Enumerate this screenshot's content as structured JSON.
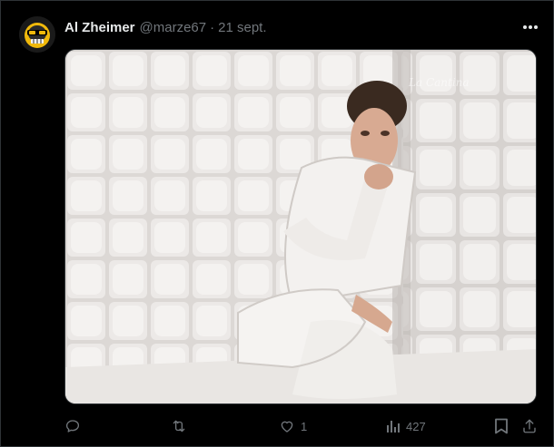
{
  "post": {
    "author_name": "Al Zheimer",
    "handle": "@marze67",
    "separator": "·",
    "date": "21 sept.",
    "avatar_icon": "skull-with-sunglasses-avatar",
    "more_icon": "more-dots-icon"
  },
  "media": {
    "description_icon": "padded-cell-photo",
    "watermark": "La Cantina"
  },
  "actions": {
    "reply": {
      "icon": "reply-icon",
      "count": ""
    },
    "repost": {
      "icon": "repost-icon",
      "count": ""
    },
    "like": {
      "icon": "heart-icon",
      "count": "1"
    },
    "views": {
      "icon": "views-chart-icon",
      "count": "427"
    },
    "bookmark": {
      "icon": "bookmark-icon"
    },
    "share": {
      "icon": "share-icon"
    }
  },
  "colors": {
    "background": "#000000",
    "text_primary": "#e7e9ea",
    "text_secondary": "#71767b",
    "border": "#2f3336"
  }
}
